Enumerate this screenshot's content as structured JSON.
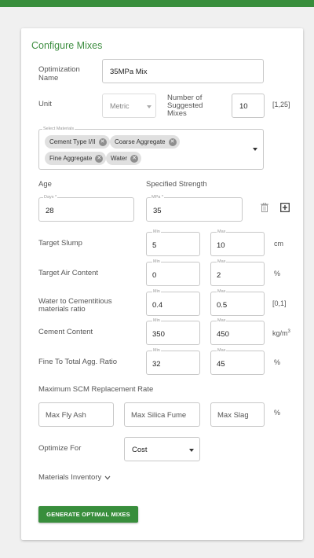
{
  "header": {
    "color": "#388e3c"
  },
  "card": {
    "title": "Configure Mixes"
  },
  "optimization_name": {
    "label": "Optimization Name",
    "value": "35MPa Mix"
  },
  "unit": {
    "label": "Unit",
    "value": "Metric"
  },
  "num_suggested": {
    "label": "Number of Suggested Mixes",
    "value": "10",
    "range": "[1,25]"
  },
  "materials": {
    "label": "Select Materials",
    "chips": [
      "Cement Type I/II",
      "Coarse Aggregate",
      "Fine Aggregate",
      "Water"
    ]
  },
  "age": {
    "heading": "Age",
    "field_label": "Days *",
    "value": "28"
  },
  "strength": {
    "heading": "Specified Strength",
    "field_label": "MPa *",
    "value": "35"
  },
  "min_label": "Min",
  "max_label": "Max",
  "target_slump": {
    "label": "Target Slump",
    "min": "5",
    "max": "10",
    "unit": "cm"
  },
  "target_air": {
    "label": "Target Air Content",
    "min": "0",
    "max": "2",
    "unit": "%"
  },
  "wc_ratio": {
    "label": "Water to Cementitious materials ratio",
    "min": "0.4",
    "max": "0.5",
    "unit": "[0,1]"
  },
  "cement_content": {
    "label": "Cement Content",
    "min": "350",
    "max": "450",
    "unit": "kg/m",
    "unit_sup": "3"
  },
  "fine_ratio": {
    "label": "Fine To Total Agg. Ratio",
    "min": "32",
    "max": "45",
    "unit": "%"
  },
  "scm": {
    "heading": "Maximum SCM Replacement Rate",
    "fly_ash": "Max Fly Ash",
    "silica_fume": "Max Silica Fume",
    "slag": "Max Slag",
    "unit": "%"
  },
  "optimize_for": {
    "label": "Optimize For",
    "value": "Cost"
  },
  "inventory": {
    "label": "Materials Inventory"
  },
  "generate_button": {
    "label": "GENERATE OPTIMAL MIXES"
  },
  "icons": {
    "delete": "trash-icon",
    "add": "add-box-icon",
    "dropdown": "caret-down-icon",
    "expand": "chevron-down-icon",
    "chip_remove": "cancel-icon"
  }
}
